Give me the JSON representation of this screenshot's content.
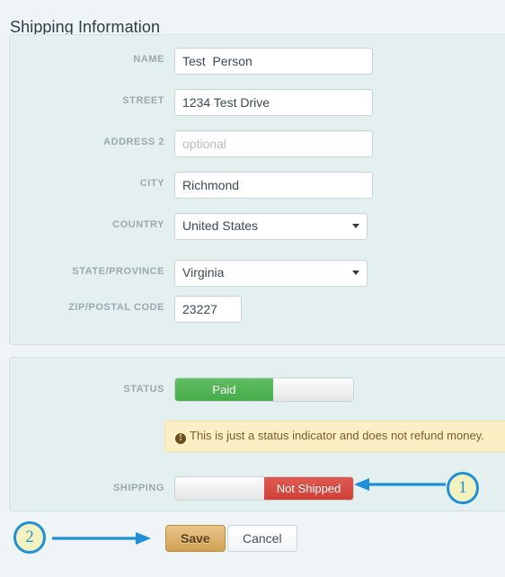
{
  "page": {
    "title": "Shipping Information",
    "background_color": "#eff5f7",
    "panel_color": "#e4eff0"
  },
  "address_panel": {
    "fields": [
      {
        "label": "NAME",
        "type": "text",
        "value": "Test  Person",
        "placeholder": ""
      },
      {
        "label": "STREET",
        "type": "text",
        "value": "1234 Test Drive",
        "placeholder": ""
      },
      {
        "label": "ADDRESS 2",
        "type": "text",
        "value": "",
        "placeholder": "optional"
      },
      {
        "label": "CITY",
        "type": "text",
        "value": "Richmond",
        "placeholder": ""
      },
      {
        "label": "COUNTRY",
        "type": "select",
        "value": "United States",
        "placeholder": ""
      },
      {
        "label": "STATE/PROVINCE",
        "type": "select",
        "value": "Virginia",
        "placeholder": ""
      },
      {
        "label": "ZIP/POSTAL CODE",
        "type": "text",
        "value": "23227",
        "placeholder": ""
      }
    ]
  },
  "status_panel": {
    "status": {
      "label": "STATUS",
      "active_text": "Paid",
      "active_color": "#4bae4f",
      "active_side": "left"
    },
    "alert": {
      "icon": "exclamation-circle-icon",
      "text": "This is just a status indicator and does not refund money.",
      "background_color": "#fcefc4",
      "text_color": "#7a5c2e"
    },
    "shipping": {
      "label": "SHIPPING",
      "active_text": "Not Shipped",
      "active_color": "#d2423a",
      "active_side": "right"
    }
  },
  "actions": {
    "save_label": "Save",
    "cancel_label": "Cancel",
    "save_color": "#d9ab60"
  },
  "annotations": {
    "markers": [
      {
        "number": "1",
        "points_to": "shipping-toggle"
      },
      {
        "number": "2",
        "points_to": "save-button"
      }
    ],
    "marker_fill": "#f2f2bf",
    "marker_stroke": "#1f8fd8"
  }
}
